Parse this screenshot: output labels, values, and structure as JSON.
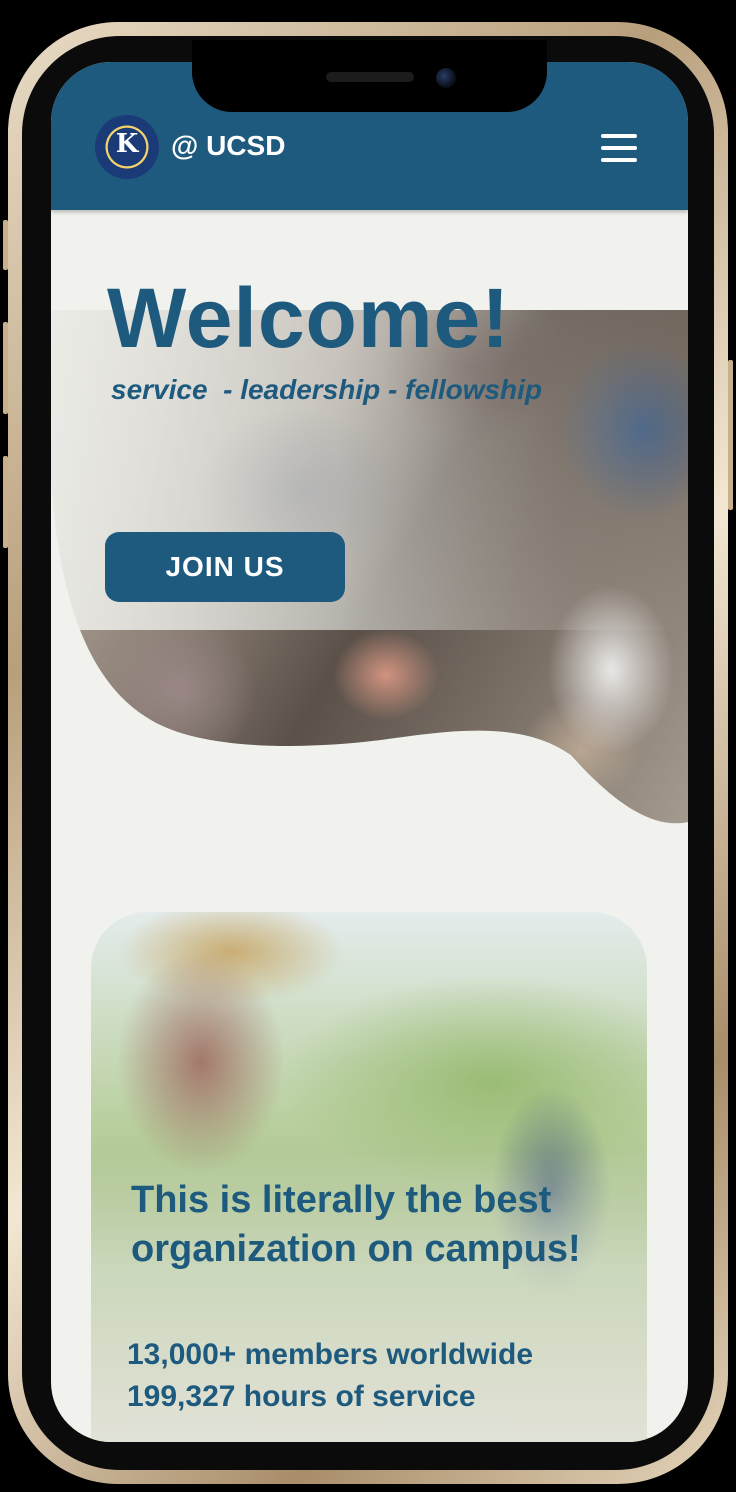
{
  "header": {
    "logo_text": "K",
    "brand": "@ UCSD",
    "menu_icon": "hamburger-menu-icon"
  },
  "hero": {
    "title": "Welcome!",
    "tagline": "service  - leadership - fellowship",
    "cta_label": "JOIN US"
  },
  "card": {
    "quote": "This is literally the best organization on campus!",
    "stats": [
      "13,000+ members worldwide",
      "199,327 hours of service"
    ]
  },
  "colors": {
    "brand_blue": "#1d5a7e",
    "background": "#f1f2ee"
  }
}
